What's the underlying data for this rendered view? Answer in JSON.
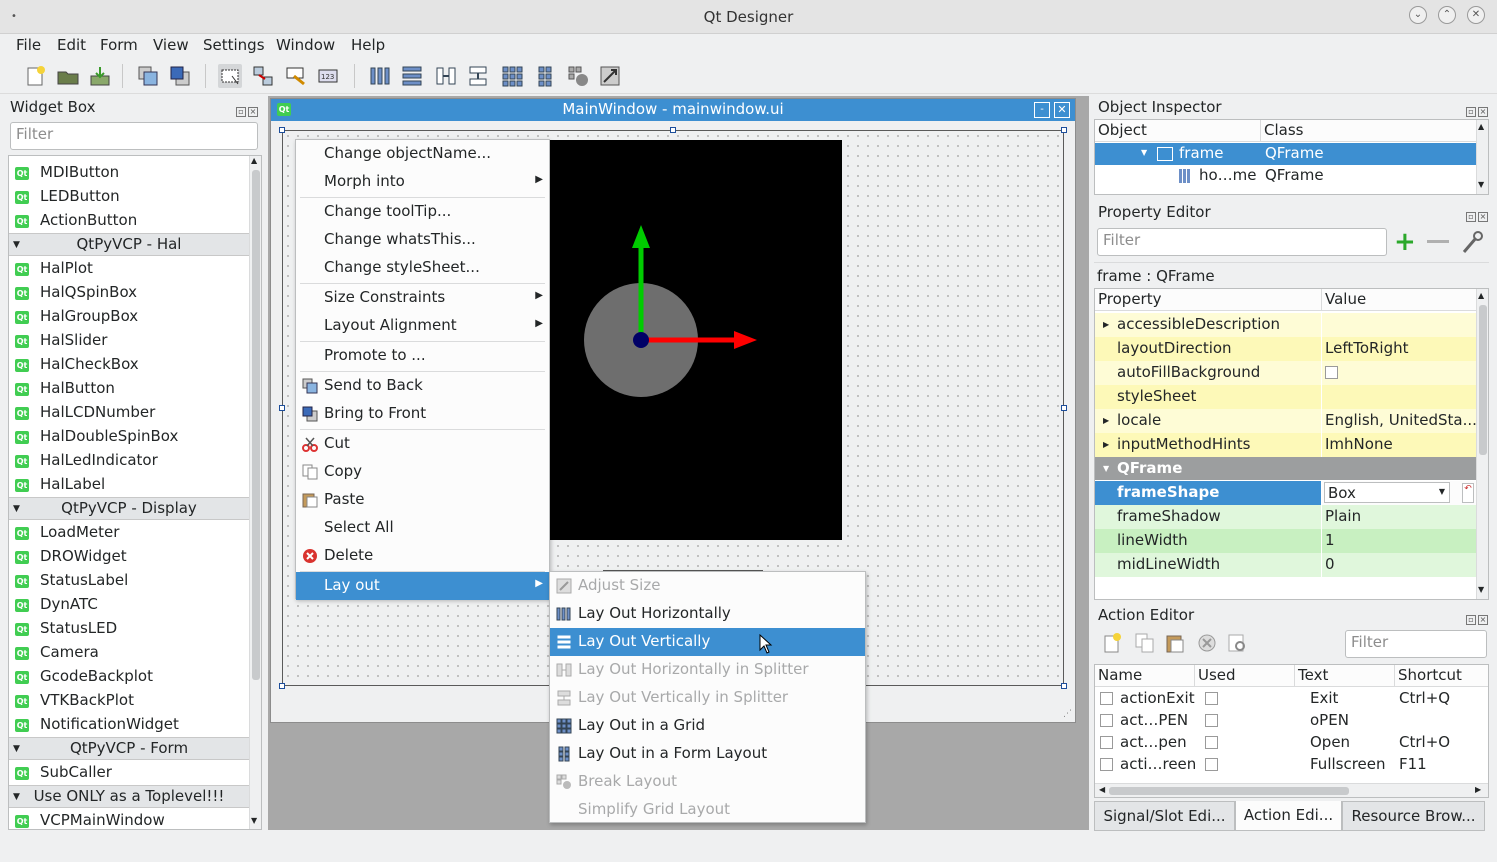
{
  "window": {
    "title": "Qt Designer"
  },
  "menubar": {
    "items": [
      "File",
      "Edit",
      "Form",
      "View",
      "Settings",
      "Window",
      "Help"
    ]
  },
  "widget_box": {
    "title": "Widget Box",
    "filter_placeholder": "Filter",
    "items_top": [
      "MDIButton",
      "LEDButton",
      "ActionButton"
    ],
    "cat_hal": "QtPyVCP - Hal",
    "items_hal": [
      "HalPlot",
      "HalQSpinBox",
      "HalGroupBox",
      "HalSlider",
      "HalCheckBox",
      "HalButton",
      "HalLCDNumber",
      "HalDoubleSpinBox",
      "HalLedIndicator",
      "HalLabel"
    ],
    "cat_display": "QtPyVCP - Display",
    "items_display": [
      "LoadMeter",
      "DROWidget",
      "StatusLabel",
      "DynATC",
      "StatusLED",
      "Camera",
      "GcodeBackplot",
      "VTKBackPlot",
      "NotificationWidget"
    ],
    "cat_form": "QtPyVCP - Form",
    "items_form": [
      "SubCaller"
    ],
    "cat_toplevel": "Use ONLY as a Toplevel!!!",
    "items_toplevel": [
      "VCPMainWindow"
    ],
    "icon_text": "Qt"
  },
  "subwindow": {
    "title": "MainWindow - mainwindow.ui",
    "icon_text": "Qt"
  },
  "context_menu": {
    "items": [
      "Change objectName...",
      "Morph into",
      "Change toolTip...",
      "Change whatsThis...",
      "Change styleSheet...",
      "Size Constraints",
      "Layout Alignment",
      "Promote to ...",
      "Send to Back",
      "Bring to Front",
      "Cut",
      "Copy",
      "Paste",
      "Select All",
      "Delete",
      "Lay out"
    ]
  },
  "layout_submenu": {
    "items": [
      "Adjust Size",
      "Lay Out Horizontally",
      "Lay Out Vertically",
      "Lay Out Horizontally in Splitter",
      "Lay Out Vertically in Splitter",
      "Lay Out in a Grid",
      "Lay Out in a Form Layout",
      "Break Layout",
      "Simplify Grid Layout"
    ]
  },
  "object_inspector": {
    "title": "Object Inspector",
    "col_object": "Object",
    "col_class": "Class",
    "rows": [
      {
        "object": "frame",
        "class": "QFrame"
      },
      {
        "object": "ho…me",
        "class": "QFrame"
      }
    ]
  },
  "property_editor": {
    "title": "Property Editor",
    "filter_placeholder": "Filter",
    "object_label": "frame : QFrame",
    "col_property": "Property",
    "col_value": "Value",
    "rows": [
      {
        "k": "accessibleDescription",
        "v": ""
      },
      {
        "k": "layoutDirection",
        "v": "LeftToRight"
      },
      {
        "k": "autoFillBackground",
        "v": ""
      },
      {
        "k": "styleSheet",
        "v": ""
      },
      {
        "k": "locale",
        "v": "English, UnitedSta..."
      },
      {
        "k": "inputMethodHints",
        "v": "ImhNone"
      }
    ],
    "section": "QFrame",
    "frame_rows": [
      {
        "k": "frameShape",
        "v": "Box"
      },
      {
        "k": "frameShadow",
        "v": "Plain"
      },
      {
        "k": "lineWidth",
        "v": "1"
      },
      {
        "k": "midLineWidth",
        "v": "0"
      }
    ]
  },
  "action_editor": {
    "title": "Action Editor",
    "filter_placeholder": "Filter",
    "cols": [
      "Name",
      "Used",
      "Text",
      "Shortcut"
    ],
    "rows": [
      {
        "name": "actionExit",
        "text": "Exit",
        "shortcut": "Ctrl+Q"
      },
      {
        "name": "act…PEN",
        "text": "oPEN",
        "shortcut": ""
      },
      {
        "name": "act…pen",
        "text": "Open",
        "shortcut": "Ctrl+O"
      },
      {
        "name": "acti…reen",
        "text": "Fullscreen",
        "shortcut": "F11"
      }
    ]
  },
  "bottom_tabs": [
    "Signal/Slot Edi...",
    "Action Edi...",
    "Resource Brow..."
  ],
  "colors": {
    "accent": "#3d8fd1",
    "canvas": "#000000",
    "axis_x": "#ff0000",
    "axis_y": "#00cc00"
  }
}
